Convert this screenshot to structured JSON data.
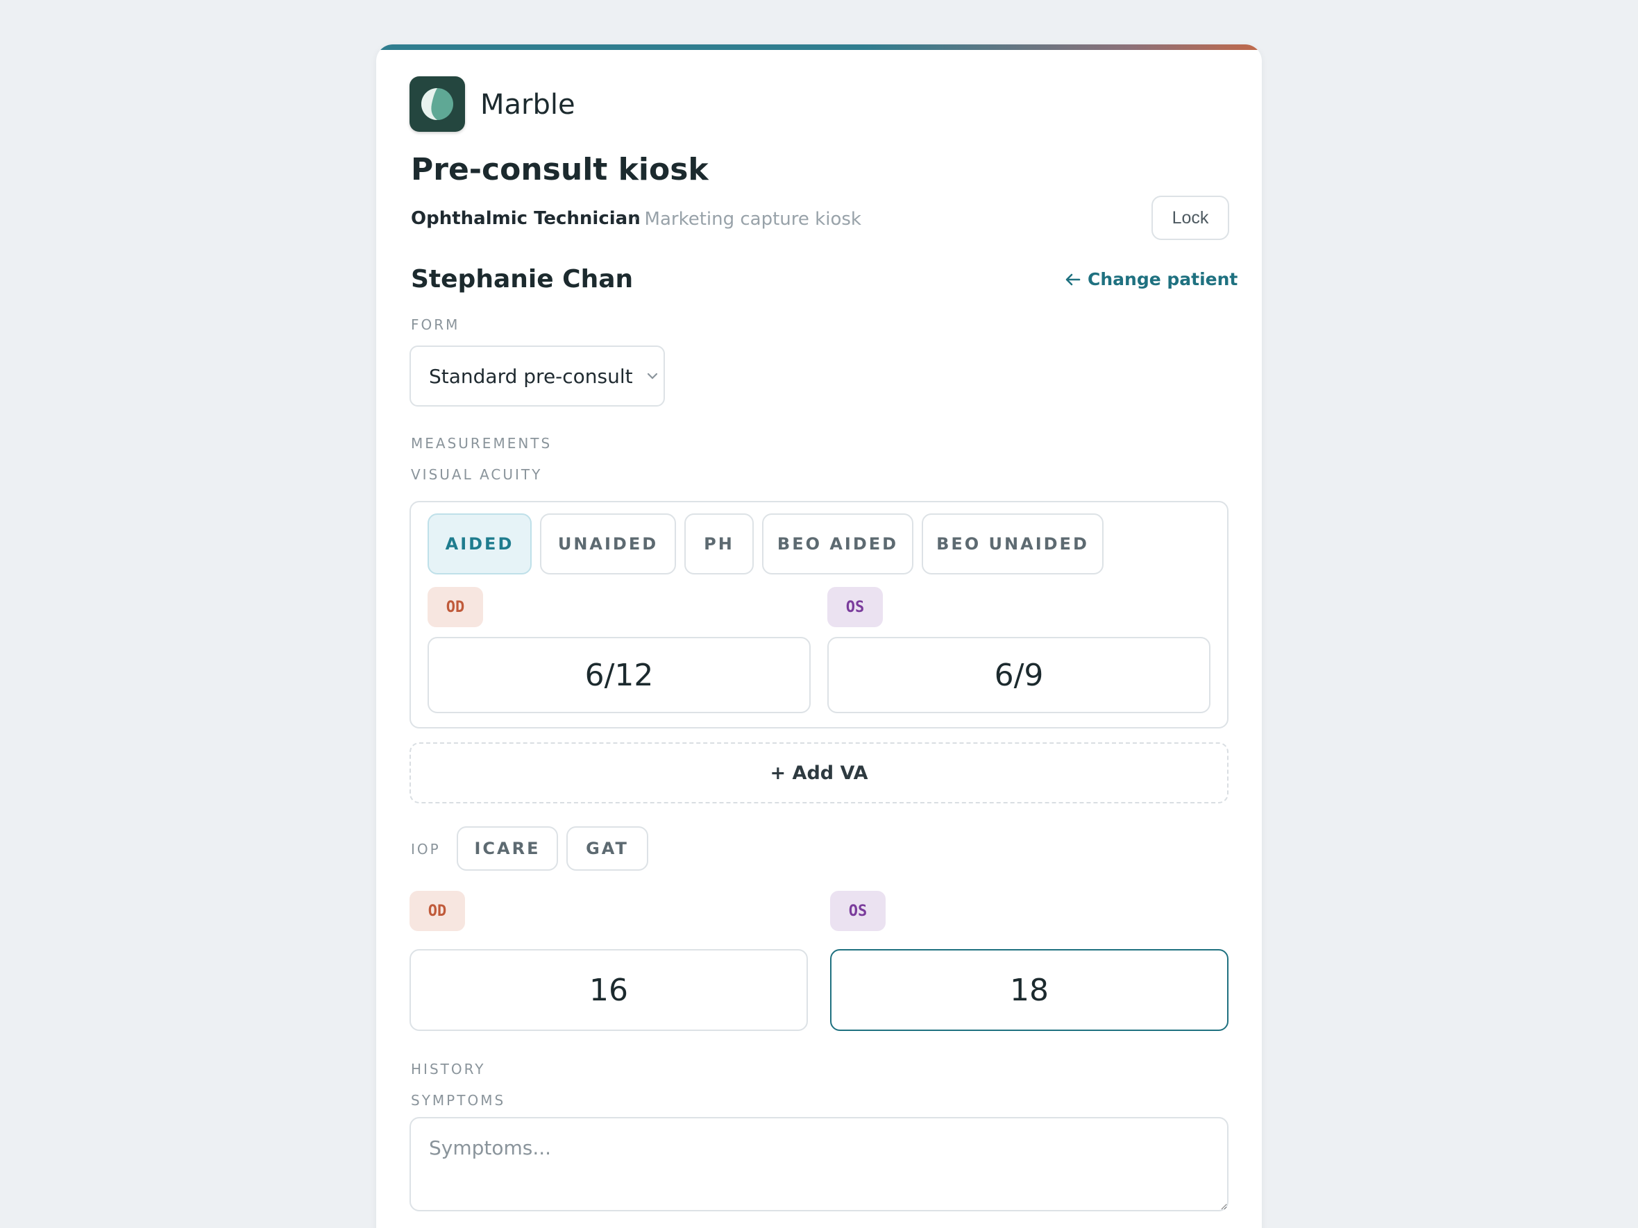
{
  "app": {
    "name": "Marble"
  },
  "header": {
    "title": "Pre-consult kiosk",
    "role": "Ophthalmic Technician",
    "context": "· Marketing capture kiosk",
    "lock_label": "Lock"
  },
  "patient": {
    "name": "Stephanie Chan",
    "change_label": "Change patient"
  },
  "form": {
    "label": "FORM",
    "selected": "Standard pre-consult"
  },
  "measurements": {
    "section_label": "MEASUREMENTS",
    "visual_acuity": {
      "label": "VISUAL ACUITY",
      "tabs": [
        {
          "label": "AIDED",
          "active": true
        },
        {
          "label": "UNAIDED",
          "active": false
        },
        {
          "label": "PH",
          "active": false
        },
        {
          "label": "BEO AIDED",
          "active": false
        },
        {
          "label": "BEO UNAIDED",
          "active": false
        }
      ],
      "od_label": "OD",
      "os_label": "OS",
      "od_value": "6/12",
      "os_value": "6/9",
      "add_label": "+ Add VA"
    },
    "iop": {
      "label": "IOP",
      "methods": [
        "ICARE",
        "GAT"
      ],
      "od_label": "OD",
      "os_label": "OS",
      "od_value": "16",
      "os_value": "18"
    }
  },
  "history": {
    "section_label": "HISTORY",
    "symptoms_label": "SYMPTOMS",
    "symptoms_placeholder": "Symptoms..."
  },
  "colors": {
    "accent": "#1f7180",
    "od": "#c05a3a",
    "os": "#7a3c9c",
    "logo_bg": "#24463f"
  }
}
